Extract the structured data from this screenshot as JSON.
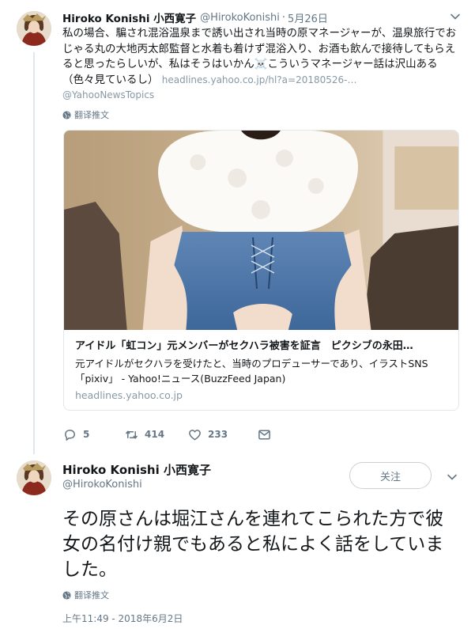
{
  "tweet1": {
    "author_name": "Hiroko Konishi 小西寛子",
    "handle": "@HirokoKonishi",
    "separator": "·",
    "date": "5月26日",
    "text_main": "私の場合、騙され混浴温泉まで誘い出され当時の原マネージャーが、温泉旅行でおじゃる丸の大地丙太郎監督と水着も着けず混浴入り、お酒も飲んで接待してもらえると思ったらしいが、私はそうはいかん☠️こういうマネージャー話は沢山ある（色々見ているし）",
    "link": "headlines.yahoo.co.jp/hl?a=20180526-…",
    "via_mention": "@YahooNewsTopics",
    "translate_label": "翻译推文",
    "card": {
      "title": "アイドル「虹コン」元メンバーがセクハラ被害を証言　ピクシブの永田…",
      "description": "元アイドルがセクハラを受けたと、当時のプロデューサーであり、イラストSNS「pixiv」 - Yahoo!ニュース(BuzzFeed Japan)",
      "domain": "headlines.yahoo.co.jp"
    },
    "actions": {
      "reply_count": "5",
      "retweet_count": "414",
      "like_count": "233"
    }
  },
  "tweet2": {
    "author_name": "Hiroko Konishi 小西寛子",
    "handle": "@HirokoKonishi",
    "follow_label": "关注",
    "text": "その原さんは堀江さんを連れてこられた方で彼女の名付け親でもあると私によく話をしていました。",
    "translate_label": "翻译推文",
    "timestamp": "上午11:49 - 2018年6月2日"
  },
  "colors": {
    "text_primary": "#14171a",
    "text_secondary": "#657786",
    "link": "#8899a6",
    "border": "#e1e8ed"
  },
  "icons": [
    "globe-icon",
    "reply-icon",
    "retweet-icon",
    "like-icon",
    "message-icon",
    "chevron-down-icon"
  ]
}
